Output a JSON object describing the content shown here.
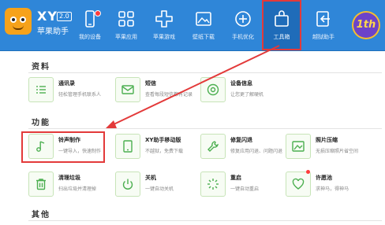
{
  "app": {
    "brand_name": "XY",
    "brand_version": "2.0",
    "brand_subtitle": "苹果助手"
  },
  "toolbar": {
    "items": [
      {
        "label": "我的设备",
        "icon": "phone-icon",
        "has_dot": true
      },
      {
        "label": "苹果应用",
        "icon": "grid-icon",
        "has_dot": false
      },
      {
        "label": "苹果游戏",
        "icon": "gamepad-icon",
        "has_dot": false
      },
      {
        "label": "壁纸下载",
        "icon": "picture-icon",
        "has_dot": false
      },
      {
        "label": "手机优化",
        "icon": "plus-circle-icon",
        "has_dot": false
      },
      {
        "label": "工具箱",
        "icon": "toolbox-icon",
        "has_dot": false,
        "active": true
      },
      {
        "label": "越狱助手",
        "icon": "escape-icon",
        "has_dot": false
      }
    ],
    "badge": "1th"
  },
  "sections": {
    "resources": {
      "title": "资料",
      "cards": [
        {
          "title": "通讯录",
          "desc": "轻松管理手机联系人",
          "icon": "contacts-icon"
        },
        {
          "title": "短信",
          "desc": "查看每段短信都有记录",
          "icon": "sms-icon"
        },
        {
          "title": "设备信息",
          "desc": "让您更了解硬机",
          "icon": "device-info-icon"
        }
      ]
    },
    "functions": {
      "title": "功能",
      "cards": [
        {
          "title": "铃声制作",
          "desc": "一键导入，快速制作",
          "icon": "music-note-icon"
        },
        {
          "title": "XY助手移动版",
          "desc": "不越狱，免费下载",
          "icon": "tablet-icon"
        },
        {
          "title": "修复闪退",
          "desc": "修复应用闪退、问题闪退",
          "icon": "wrench-icon"
        },
        {
          "title": "照片压缩",
          "desc": "无损压缩照片省空间",
          "icon": "photo-compress-icon"
        },
        {
          "title": "清理垃圾",
          "desc": "扫出垃圾并清理掉",
          "icon": "trash-icon"
        },
        {
          "title": "关机",
          "desc": "一键自动关机",
          "icon": "power-icon"
        },
        {
          "title": "重启",
          "desc": "一键自动重启",
          "icon": "restart-icon"
        },
        {
          "title": "许愿池",
          "desc": "求神马，得神马",
          "icon": "heart-icon",
          "has_dot": true
        }
      ]
    },
    "others": {
      "title": "其他"
    }
  },
  "colors": {
    "toolbar_bg": "#2f86d8",
    "active_bg": "#1f6cb9",
    "highlight": "#e33a3a",
    "icon_green": "#4caf50"
  }
}
